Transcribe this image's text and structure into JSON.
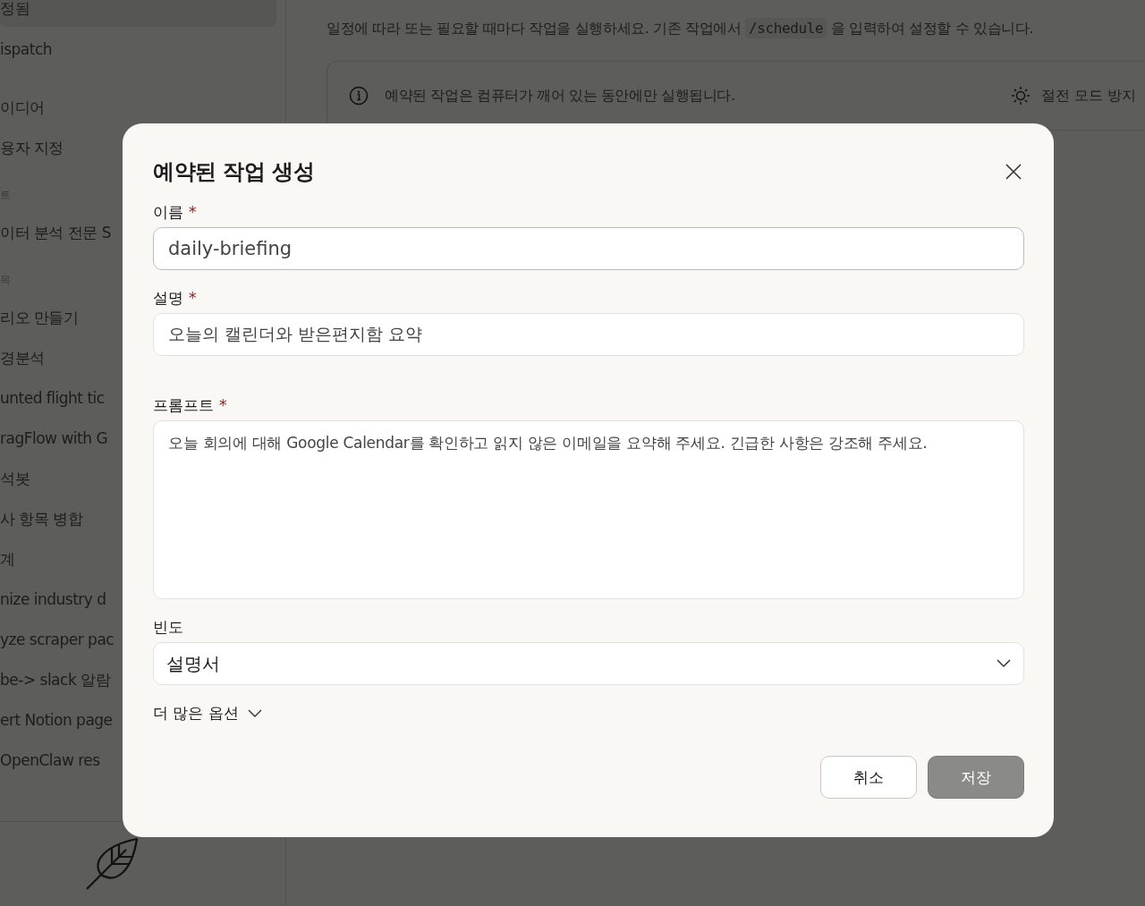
{
  "sidebar": {
    "items": [
      {
        "kind": "item",
        "text": "정됨",
        "selected": true
      },
      {
        "kind": "item",
        "text": "ispatch",
        "selected": false
      },
      {
        "kind": "gap"
      },
      {
        "kind": "item",
        "text": "이디어",
        "selected": false
      },
      {
        "kind": "item",
        "text": "용자 지정",
        "selected": false
      },
      {
        "kind": "section",
        "text": "트"
      },
      {
        "kind": "item",
        "text": "이터 분석 전문 S",
        "selected": false
      },
      {
        "kind": "section",
        "text": "목"
      },
      {
        "kind": "item",
        "text": "리오 만들기",
        "selected": false
      },
      {
        "kind": "item",
        "text": "경분석",
        "selected": false
      },
      {
        "kind": "item",
        "text": "unted flight tic",
        "selected": false
      },
      {
        "kind": "item",
        "text": "ragFlow with G",
        "selected": false
      },
      {
        "kind": "item",
        "text": "석봇",
        "selected": false
      },
      {
        "kind": "item",
        "text": "사 항목 병합",
        "selected": false
      },
      {
        "kind": "item",
        "text": "계",
        "selected": false
      },
      {
        "kind": "item",
        "text": "nize industry d",
        "selected": false
      },
      {
        "kind": "item",
        "text": "yze scraper pac",
        "selected": false
      },
      {
        "kind": "item",
        "text": "be-> slack 알람",
        "selected": false
      },
      {
        "kind": "item",
        "text": "ert Notion page",
        "selected": false
      },
      {
        "kind": "item",
        "text": "OpenClaw res",
        "selected": false
      }
    ]
  },
  "main": {
    "intro_before": "일정에 따라 또는 필요할 때마다 작업을 실행하세요. 기존 작업에서",
    "intro_code": "/schedule",
    "intro_after": "을 입력하여 설정할 수 있습니다.",
    "notice": "예약된 작업은 컴퓨터가 깨어 있는 동안에만 실행됩니다.",
    "keep_awake": "절전 모드 방지"
  },
  "dialog": {
    "title": "예약된 작업 생성",
    "required_mark": "*",
    "fields": [
      {
        "kind": "input",
        "label": "이름",
        "required": true,
        "value": "daily-briefing"
      },
      {
        "kind": "input",
        "label": "설명",
        "required": true,
        "value": "오늘의 캘린더와 받은편지함 요약"
      },
      {
        "kind": "textarea",
        "label": "프롬프트",
        "required": true,
        "value": "오늘 회의에 대해 Google Calendar를 확인하고 읽지 않은 이메일을 요약해 주세요. 긴급한 사항은 강조해 주세요."
      },
      {
        "kind": "select",
        "label": "빈도",
        "required": false,
        "value": "설명서"
      }
    ],
    "more_options": "더 많은 옵션",
    "buttons": [
      {
        "kind": "secondary",
        "label": "취소"
      },
      {
        "kind": "primary",
        "label": "저장"
      }
    ]
  }
}
